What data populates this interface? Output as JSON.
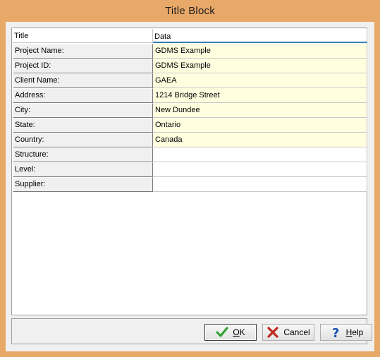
{
  "window": {
    "title": "Title Block"
  },
  "grid": {
    "columns": [
      "Title",
      "Data"
    ],
    "rows": [
      {
        "title": "Project Name:",
        "data": "GDMS Example"
      },
      {
        "title": "Project ID:",
        "data": "GDMS Example"
      },
      {
        "title": "Client Name:",
        "data": "GAEA"
      },
      {
        "title": "Address:",
        "data": "1214 Bridge Street"
      },
      {
        "title": "City:",
        "data": "New Dundee"
      },
      {
        "title": "State:",
        "data": "Ontario"
      },
      {
        "title": "Country:",
        "data": "Canada"
      },
      {
        "title": "Structure:",
        "data": ""
      },
      {
        "title": "Level:",
        "data": ""
      },
      {
        "title": "Supplier:",
        "data": ""
      }
    ]
  },
  "buttons": {
    "ok": {
      "label": "OK",
      "mnemonic": "O"
    },
    "cancel": {
      "label": "Cancel"
    },
    "help": {
      "label": "Help",
      "mnemonic": "H"
    }
  },
  "colors": {
    "frame": "#e8a868",
    "filled_cell": "#ffffe0",
    "ok_icon": "#2e9e2e",
    "cancel_icon": "#c0281e",
    "help_icon": "#1a4fb0"
  }
}
